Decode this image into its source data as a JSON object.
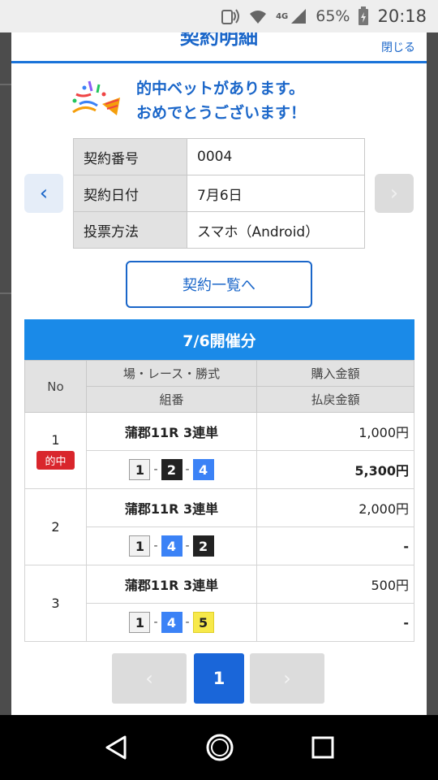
{
  "status_bar": {
    "network": "4G",
    "battery_percent": "65%",
    "time": "20:18"
  },
  "modal": {
    "title": "契約明細",
    "close_label": "閉じる",
    "congrats_line1": "的中ベットがあります。",
    "congrats_line2": "おめでとうございます！",
    "info": [
      {
        "label": "契約番号",
        "value": "0004"
      },
      {
        "label": "契約日付",
        "value": "7月6日"
      },
      {
        "label": "投票方法",
        "value": "スマホ（Android）"
      }
    ],
    "list_button_label": "契約一覧へ",
    "section_header": "7/6開催分",
    "table": {
      "col_no": "No",
      "col_race": "場・レース・勝式",
      "col_combo": "組番",
      "col_purchase": "購入金額",
      "col_payout": "払戻金額"
    },
    "rows": [
      {
        "no": "1",
        "hit": "的中",
        "race": "蒲郡11R 3連単",
        "combo": [
          "1",
          "2",
          "4"
        ],
        "purchase": "1,000円",
        "payout": "5,300円"
      },
      {
        "no": "2",
        "race": "蒲郡11R 3連単",
        "combo": [
          "1",
          "4",
          "2"
        ],
        "purchase": "2,000円",
        "payout": "-"
      },
      {
        "no": "3",
        "race": "蒲郡11R 3連単",
        "combo": [
          "1",
          "4",
          "5"
        ],
        "purchase": "500円",
        "payout": "-"
      }
    ],
    "pager": {
      "current": "1",
      "prev": "‹",
      "next": "›"
    },
    "nav_prev": "‹",
    "nav_next": "›"
  },
  "colors": {
    "accent": "#1a66c9",
    "header_bar": "#1a8ae8",
    "hit_badge": "#d9262c"
  }
}
